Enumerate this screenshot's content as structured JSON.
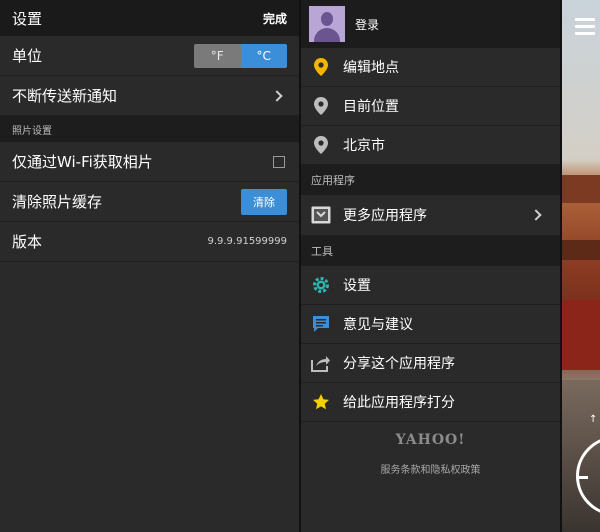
{
  "settings": {
    "title": "设置",
    "done": "完成",
    "unit_label": "单位",
    "unit_options": [
      "°F",
      "°C"
    ],
    "unit_selected": "°C",
    "push_label": "不断传送新通知",
    "photo_section": "照片设置",
    "wifi_label": "仅通过Wi-Fi获取相片",
    "wifi_checked": false,
    "clear_cache_label": "清除照片缓存",
    "clear_button": "清除",
    "version_label": "版本",
    "version_value": "9.9.9.91599999"
  },
  "drawer": {
    "login": "登录",
    "locations": [
      {
        "label": "编辑地点",
        "icon": "location-pin-icon",
        "color": "#f5b400"
      },
      {
        "label": "目前位置",
        "icon": "location-pin-icon",
        "color": "#bdbdbd"
      },
      {
        "label": "北京市",
        "icon": "location-pin-icon",
        "color": "#bdbdbd"
      }
    ],
    "apps_section": "应用程序",
    "more_apps": "更多应用程序",
    "tools_section": "工具",
    "tools": [
      {
        "label": "设置",
        "icon": "gear-icon",
        "color": "#2bb7b0"
      },
      {
        "label": "意见与建议",
        "icon": "chat-bubble-icon",
        "color": "#3b8fd8"
      },
      {
        "label": "分享这个应用程序",
        "icon": "share-icon",
        "color": "#bdbdbd"
      },
      {
        "label": "给此应用程序打分",
        "icon": "star-icon",
        "color": "#f5d000"
      }
    ],
    "logo": "YAHOO!",
    "terms": "服务条款和隐私权政策"
  },
  "background": {
    "arrow": "↑"
  },
  "colors": {
    "accent": "#3b8fd8",
    "panel": "#2a2a2a",
    "section": "#1d1d1d"
  }
}
